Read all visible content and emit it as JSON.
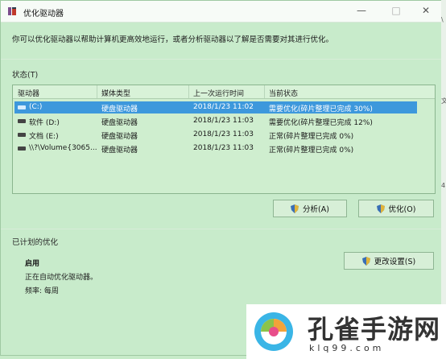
{
  "window": {
    "title": "优化驱动器",
    "minimize": "—",
    "maximize": "□",
    "close": "✕"
  },
  "description": "你可以优化驱动器以帮助计算机更高效地运行，或者分析驱动器以了解是否需要对其进行优化。",
  "status_section": {
    "label": "状态(T)"
  },
  "table": {
    "columns": [
      "驱动器",
      "媒体类型",
      "上一次运行时间",
      "当前状态"
    ],
    "rows": [
      {
        "drive": "(C:)",
        "media": "硬盘驱动器",
        "last_run": "2018/1/23 11:02",
        "status": "需要优化(碎片整理已完成 30%)",
        "selected": true
      },
      {
        "drive": "软件 (D:)",
        "media": "硬盘驱动器",
        "last_run": "2018/1/23 11:03",
        "status": "需要优化(碎片整理已完成 12%)",
        "selected": false
      },
      {
        "drive": "文档 (E:)",
        "media": "硬盘驱动器",
        "last_run": "2018/1/23 11:03",
        "status": "正常(碎片整理已完成 0%)",
        "selected": false
      },
      {
        "drive": "\\\\?\\Volume{3065...",
        "media": "硬盘驱动器",
        "last_run": "2018/1/23 11:03",
        "status": "正常(碎片整理已完成 0%)",
        "selected": false
      }
    ]
  },
  "buttons": {
    "analyze": "分析(A)",
    "optimize": "优化(O)",
    "change_settings": "更改设置(S)"
  },
  "scheduled": {
    "label": "已计划的优化",
    "state": "启用",
    "status": "正在自动优化驱动器。",
    "frequency": "频率: 每周"
  },
  "right_edge": {
    "glyph_1": "\\",
    "glyph_2": "文",
    "glyph_3": "4"
  },
  "watermark": {
    "text": "孔雀手游网",
    "url": "klq99.com"
  },
  "colors": {
    "window_bg": "#c8ebcb",
    "selection": "#3d98dc",
    "titlebar": "#f7fbf7"
  }
}
